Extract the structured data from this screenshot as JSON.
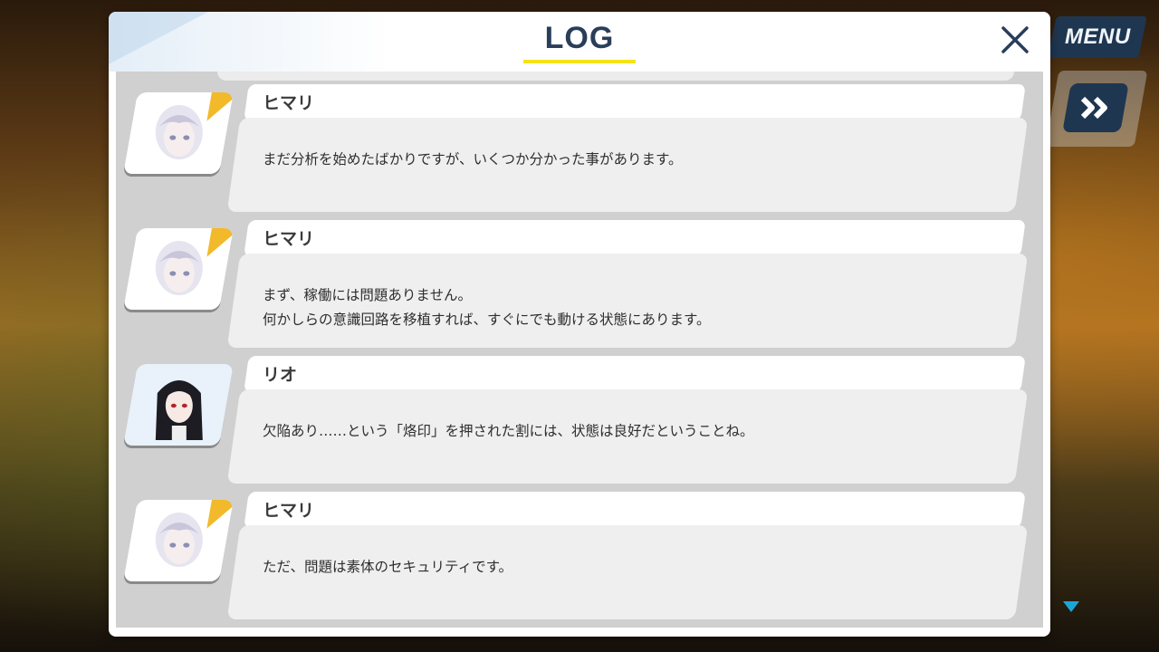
{
  "header": {
    "title": "LOG",
    "close_label": "×"
  },
  "background": {
    "menu_label": "MENU",
    "skip_icon": "double-chevron-right-icon",
    "scroll_icon": "triangle-down-icon"
  },
  "colors": {
    "title": "#2a3e5a",
    "accent_yellow": "#f5e31a",
    "portrait_stripe": "#f2b92a",
    "button_navy": "#1f3650",
    "scroll_arrow": "#1aa7d8"
  },
  "entries": [
    {
      "speaker": "ヒマリ",
      "portrait": "himari-portrait",
      "lines": [
        "まだ分析を始めたばかりですが、いくつか分かった事があります。"
      ]
    },
    {
      "speaker": "ヒマリ",
      "portrait": "himari-portrait",
      "lines": [
        "まず、稼働には問題ありません。",
        "何かしらの意識回路を移植すれば、すぐにでも動ける状態にあります。"
      ]
    },
    {
      "speaker": "リオ",
      "portrait": "rio-portrait",
      "lines": [
        "欠陥あり……という「烙印」を押された割には、状態は良好だということね。"
      ]
    },
    {
      "speaker": "ヒマリ",
      "portrait": "himari-portrait",
      "lines": [
        "ただ、問題は素体のセキュリティです。"
      ]
    }
  ]
}
